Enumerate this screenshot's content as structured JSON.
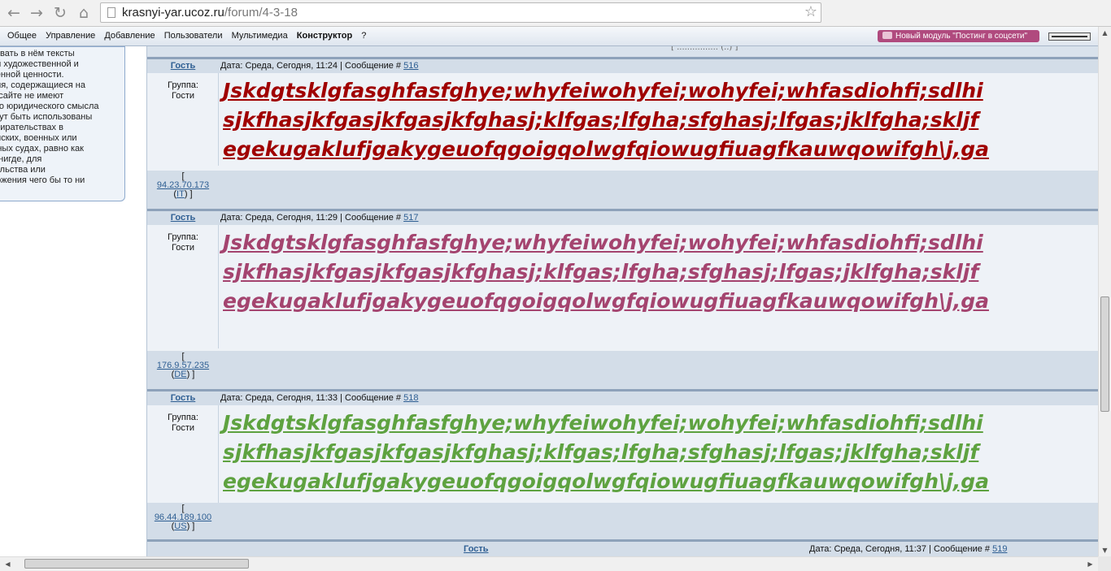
{
  "browser": {
    "url_domain": "krasnyi-yar.ucoz.ru",
    "url_path": "/forum/4-3-18",
    "back_icon": "←",
    "forward_icon": "→",
    "reload_icon": "↻",
    "home_icon": "⌂",
    "bookmark_icon": "☆"
  },
  "adminbar": {
    "menu": [
      "Общее",
      "Управление",
      "Добавление",
      "Пользователи",
      "Мультимедиа",
      "Конструктор",
      "?"
    ],
    "promo_label": "Новый модуль \"Постинг в соцсети\""
  },
  "sidebar": {
    "lines": [
      "ковать в нём тексты",
      "ой художественной и",
      "венной ценности.",
      "ния, содержащиеся на",
      "и сайте не имеют",
      "ого юридического смысла",
      "огут быть использованы",
      "збирательствах в",
      "анских, военных или",
      "жных судах, равно как",
      "е нигде, для",
      "тельства или",
      "ержения чего бы то ни"
    ]
  },
  "forum": {
    "topline": "[ ................ (..) ]",
    "posts": [
      {
        "author": "Гость",
        "meta_text": "Дата: Среда, Сегодня, 11:24 | Сообщение # ",
        "post_num": "516",
        "group_label": "Группа:",
        "group_value": "Гости",
        "ip_open": "[",
        "ip": "94.23.70.173",
        "country": "IT",
        "color": "#a00000",
        "lines": [
          "Jskdgtsklgfasghfasfghye;whyfeiwohyfei;wohyfei;whfasdiohfi;sdlhi",
          "sjkfhasjkfgasjkfgasjkfghasj;klfgas;lfgha;sfghasj;lfgas;jklfgha;skljf",
          "egekugaklufjgakygeuofqgoigqolwgfqiowugfiuagfkauwqowifgh\\j,ga"
        ]
      },
      {
        "author": "Гость",
        "meta_text": "Дата: Среда, Сегодня, 11:29 | Сообщение # ",
        "post_num": "517",
        "group_label": "Группа:",
        "group_value": "Гости",
        "ip_open": "[",
        "ip": "176.9.57.235",
        "country": "DE",
        "color": "#a4446f",
        "lines": [
          "Jskdgtsklgfasghfasfghye;whyfeiwohyfei;wohyfei;whfasdiohfi;sdlhi",
          "sjkfhasjkfgasjkfgasjkfghasj;klfgas;lfgha;sfghasj;lfgas;jklfgha;skljf",
          "egekugaklufjgakygeuofqgoigqolwgfqiowugfiuagfkauwqowifgh\\j,ga"
        ]
      },
      {
        "author": "Гость",
        "meta_text": "Дата: Среда, Сегодня, 11:33 | Сообщение # ",
        "post_num": "518",
        "group_label": "Группа:",
        "group_value": "Гости",
        "ip_open": "[",
        "ip": "96.44.189.100",
        "country": "US",
        "color": "#5ea240",
        "lines": [
          "Jskdgtsklgfasghfasfghye;whyfeiwohyfei;wohyfei;whfasdiohfi;sdlhi",
          "sjkfhasjkfgasjkfgasjkfghasj;klfgas;lfgha;sfghasj;lfgas;jklfgha;skljf",
          "egekugaklufjgakygeuofqgoigqolwgfqiowugfiuagfkauwqowifgh\\j,ga"
        ]
      }
    ],
    "last_post": {
      "author": "Гость",
      "meta_text": "Дата: Среда, Сегодня, 11:37 | Сообщение # ",
      "post_num": "519"
    }
  }
}
